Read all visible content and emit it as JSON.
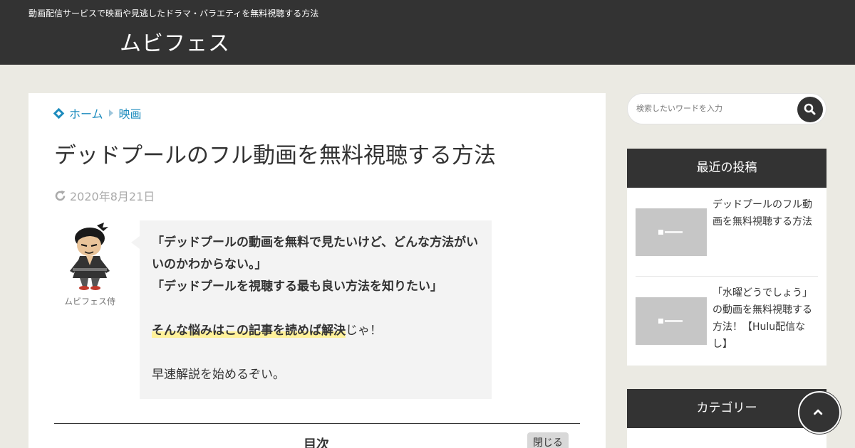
{
  "header": {
    "tagline": "動画配信サービスで映画や見逃したドラマ・バラエティを無料視聴する方法",
    "site_title": "ムビフェス"
  },
  "breadcrumb": {
    "home_label": "ホーム",
    "category_label": "映画"
  },
  "post": {
    "title": "デッドプールのフル動画を無料視聴する方法",
    "updated_date": "2020年8月21日",
    "speaker_name": "ムビフェス侍",
    "bubble": {
      "line1": "「デッドプールの動画を無料で見たいけど、どんな方法がいいのかわからない。」",
      "line2": "「デッドプールを視聴する最も良い方法を知りたい」",
      "highlight": "そんな悩みはこの記事を読めば解決",
      "highlight_suffix": "じゃ！",
      "closing": "早速解説を始めるぞい。"
    },
    "toc": {
      "title": "目次",
      "close_label": "閉じる"
    }
  },
  "sidebar": {
    "search_placeholder": "検索したいワードを入力",
    "recent_title": "最近の投稿",
    "recent_posts": [
      {
        "title": "デッドプールのフル動画を無料視聴する方法"
      },
      {
        "title": "「水曜どうでしょう」の動画を無料視聴する方法！【Hulu配信なし】"
      }
    ],
    "category_title": "カテゴリー"
  },
  "colors": {
    "header_bg": "#333333",
    "page_bg": "#ebeae3",
    "link": "#1e8cbe",
    "highlight": "#fff19a"
  }
}
